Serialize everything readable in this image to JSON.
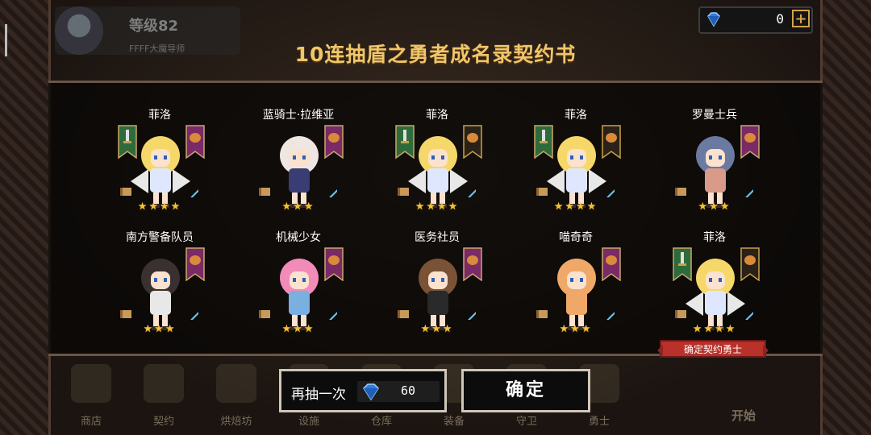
{
  "hud": {
    "level": "等级82",
    "subtitle": "FFFF大魔导师",
    "gems": "0",
    "plus": "+"
  },
  "overlay": {
    "title": "10连抽盾之勇者成名录契约书"
  },
  "cards": [
    {
      "name": "菲洛",
      "stars": "★★★★",
      "hair": "#f6d86a",
      "outfit": "#dfe7ff",
      "banners": [
        "green",
        "purple"
      ],
      "wings": true
    },
    {
      "name": "蓝骑士·拉维亚",
      "stars": "★★★",
      "hair": "#efe6e2",
      "outfit": "#3a3d73",
      "banners": [
        "purple"
      ],
      "wings": false
    },
    {
      "name": "菲洛",
      "stars": "★★★★",
      "hair": "#f6d86a",
      "outfit": "#dfe7ff",
      "banners": [
        "green",
        "dark"
      ],
      "wings": true
    },
    {
      "name": "菲洛",
      "stars": "★★★★",
      "hair": "#f6d86a",
      "outfit": "#dfe7ff",
      "banners": [
        "green",
        "dark"
      ],
      "wings": true
    },
    {
      "name": "罗曼士兵",
      "stars": "★★★",
      "hair": "#6a7aa0",
      "outfit": "#d99a8a",
      "banners": [
        "purple"
      ],
      "wings": false
    },
    {
      "name": "南方警备队员",
      "stars": "★★★",
      "hair": "#3a3030",
      "outfit": "#e8e8e8",
      "banners": [
        "purple"
      ],
      "wings": false
    },
    {
      "name": "机械少女",
      "stars": "★★★",
      "hair": "#f28bb8",
      "outfit": "#7ab0e0",
      "banners": [
        "purple"
      ],
      "wings": false
    },
    {
      "name": "医务社员",
      "stars": "★★★",
      "hair": "#7a5236",
      "outfit": "#2a2a2a",
      "banners": [
        "purple"
      ],
      "wings": false
    },
    {
      "name": "喵奇奇",
      "stars": "★★★",
      "hair": "#f0a868",
      "outfit": "#f0a868",
      "banners": [
        "purple"
      ],
      "wings": false
    },
    {
      "name": "菲洛",
      "stars": "★★★★",
      "hair": "#f6d86a",
      "outfit": "#dfe7ff",
      "banners": [
        "green",
        "dark"
      ],
      "wings": true
    }
  ],
  "confirm_tag": "确定契约勇士",
  "buttons": {
    "again_label": "再抽一次",
    "again_cost": "60",
    "ok_label": "确定"
  },
  "nav": [
    "商店",
    "契约",
    "烘焙坊",
    "设施",
    "仓库",
    "装备",
    "守卫",
    "勇士"
  ],
  "start": "开始",
  "colors": {
    "accent": "#f0c66a",
    "star": "#f2c23a",
    "banner_purple": "#7a2a66",
    "banner_green": "#2f6b3a",
    "tag": "#b8312b"
  }
}
